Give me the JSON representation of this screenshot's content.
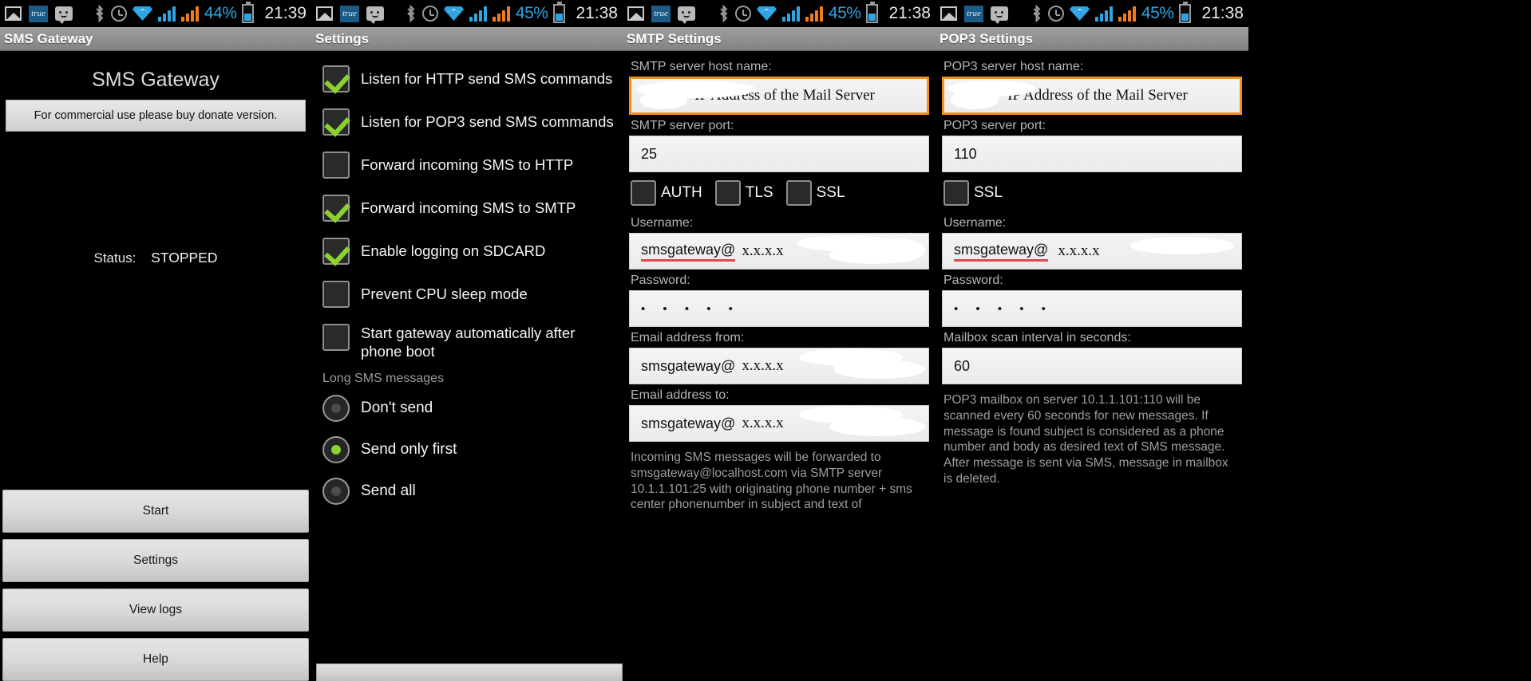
{
  "statusbars": [
    {
      "battery_pct": "44%",
      "clock": "21:39"
    },
    {
      "battery_pct": "45%",
      "clock": "21:38"
    },
    {
      "battery_pct": "45%",
      "clock": "21:38"
    },
    {
      "battery_pct": "45%",
      "clock": "21:38"
    }
  ],
  "icons": {
    "photo": "photo-icon",
    "true": "true",
    "sms": "sms-icon",
    "bluetooth": "bluetooth-icon",
    "alarm": "alarm-icon",
    "wifi": "wifi-icon",
    "signal1": "signal-bars-icon",
    "signal2": "signal-bars-icon",
    "battery": "battery-icon"
  },
  "colors": {
    "accent_orange": "#f29120",
    "check_green": "#8bd22f",
    "status_blue": "#2fa4e0",
    "signal_orange": "#f07c1c",
    "spell_red": "#e2464f"
  },
  "panel_main": {
    "titlebar": "SMS Gateway",
    "app_title": "SMS Gateway",
    "donate_notice": "For commercial use please buy donate version.",
    "status_label": "Status:",
    "status_value": "STOPPED",
    "buttons": [
      {
        "label": "Start"
      },
      {
        "label": "Settings"
      },
      {
        "label": "View logs"
      },
      {
        "label": "Help"
      }
    ]
  },
  "panel_settings": {
    "titlebar": "Settings",
    "checkboxes": [
      {
        "label": "Listen for HTTP send SMS commands",
        "checked": true
      },
      {
        "label": "Listen for POP3 send SMS commands",
        "checked": true
      },
      {
        "label": "Forward incoming SMS to HTTP",
        "checked": false
      },
      {
        "label": "Forward incoming SMS to SMTP",
        "checked": true
      },
      {
        "label": "Enable logging on SDCARD",
        "checked": true
      },
      {
        "label": "Prevent CPU sleep mode",
        "checked": false
      },
      {
        "label": "Start gateway automatically after phone boot",
        "checked": false
      }
    ],
    "radio_group_label": "Long SMS messages",
    "radios": [
      {
        "label": "Don't send",
        "selected": false
      },
      {
        "label": "Send only first",
        "selected": true
      },
      {
        "label": "Send all",
        "selected": false
      }
    ]
  },
  "panel_smtp": {
    "titlebar": "SMTP Settings",
    "host_label": "SMTP server host name:",
    "host_value": "IP Address of the Mail Server",
    "port_label": "SMTP server port:",
    "port_value": "25",
    "auth_label": "AUTH",
    "auth_checked": false,
    "tls_label": "TLS",
    "tls_checked": false,
    "ssl_label": "SSL",
    "ssl_checked": false,
    "username_label": "Username:",
    "username_value": "smsgateway@",
    "username_redacted": "x.x.x.x",
    "password_label": "Password:",
    "password_value": "• • • • •",
    "email_from_label": "Email address from:",
    "email_from_value": "smsgateway@",
    "email_from_redacted": "x.x.x.x",
    "email_to_label": "Email address to:",
    "email_to_value": "smsgateway@",
    "email_to_redacted": "x.x.x.x",
    "help_text": "Incoming SMS messages will be forwarded to smsgateway@localhost.com via SMTP server 10.1.1.101:25 with originating phone number + sms center phonenumber in subject and text of"
  },
  "panel_pop3": {
    "titlebar": "POP3 Settings",
    "host_label": "POP3 server host name:",
    "host_value": "IP Address of the Mail Server",
    "port_label": "POP3 server port:",
    "port_value": "110",
    "ssl_label": "SSL",
    "ssl_checked": false,
    "username_label": "Username:",
    "username_value": "smsgateway@",
    "username_redacted": "x.x.x.x",
    "password_label": "Password:",
    "password_value": "• • • • •",
    "scan_label": "Mailbox scan interval in seconds:",
    "scan_value": "60",
    "help_text": "POP3 mailbox on server 10.1.1.101:110 will be scanned every 60 seconds for new messages. If message is found subject is considered as a phone number and body as desired text of SMS message. After message is sent via SMS, message in mailbox is deleted."
  }
}
